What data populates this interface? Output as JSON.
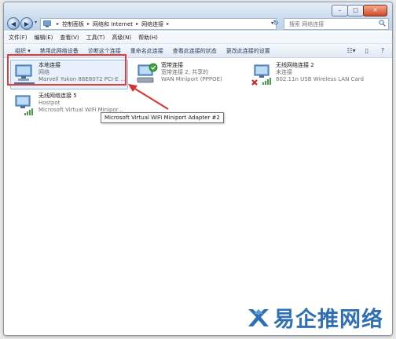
{
  "address_bar": {
    "breadcrumb": [
      "控制面板",
      "网络和 Internet",
      "网络连接"
    ]
  },
  "search": {
    "placeholder": "搜索 网络连接"
  },
  "menu": [
    "文件(F)",
    "编辑(E)",
    "查看(V)",
    "工具(T)",
    "高级(N)",
    "帮助(H)"
  ],
  "toolbar": {
    "items": [
      "组织 ▾",
      "禁用此网络设备",
      "诊断这个连接",
      "重命名此连接",
      "查看此连接的状态",
      "更改此连接的设置"
    ]
  },
  "connections": [
    {
      "name": "本地连接",
      "status": "网络",
      "device": "Marvell Yukon 88E8072 PCI-E ..."
    },
    {
      "name": "宽带连接",
      "status": "宽带连接 2, 共享的",
      "device": "WAN Miniport (PPPOE)"
    },
    {
      "name": "无线网络连接 2",
      "status": "未连接",
      "device": "802.11n USB Wireless LAN Card"
    },
    {
      "name": "无线网络连接 5",
      "status": "Hostpot",
      "device": "Microsoft Virtual WiFi Minipor..."
    }
  ],
  "tooltip": "Microsoft Virtual WiFi Miniport Adapter #2",
  "colors": {
    "highlight": "#e23b3b",
    "arrow": "#d93030",
    "selected_bg": "#e8f1fc"
  },
  "watermark": {
    "text": "易企推网络"
  }
}
